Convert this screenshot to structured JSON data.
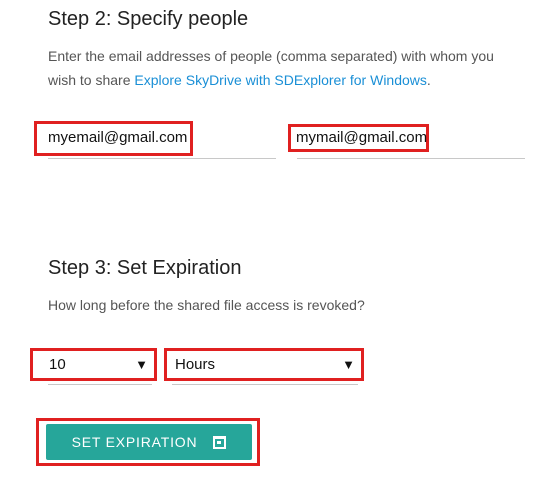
{
  "step2": {
    "title": "Step 2: Specify people",
    "desc_prefix": "Enter the email addresses of people (comma separated) with whom you wish to share ",
    "link_text": "Explore SkyDrive with SDExplorer for Windows",
    "desc_suffix": ".",
    "email_field_1": "myemail@gmail.com",
    "email_field_2": "mymail@gmail.com"
  },
  "step3": {
    "title": "Step 3: Set Expiration",
    "desc": "How long before the shared file access is revoked?",
    "amount_value": "10",
    "unit_value": "Hours",
    "dropdown_arrow": "▼"
  },
  "button": {
    "label": "SET EXPIRATION",
    "icon": "calendar-icon"
  },
  "colors": {
    "highlight": "#e02020",
    "link": "#1a8fd6",
    "button": "#26a69a"
  }
}
